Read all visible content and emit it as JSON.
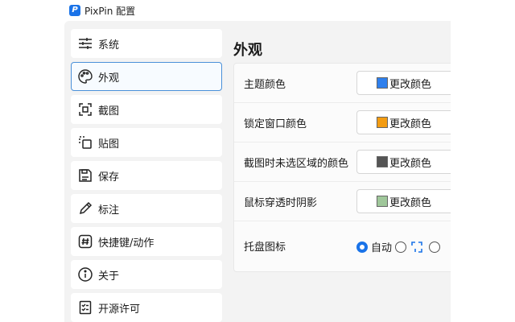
{
  "window": {
    "title": "PixPin 配置",
    "logo_letter": "P"
  },
  "sidebar": {
    "items": [
      {
        "label": "系统",
        "icon": "sliders-icon"
      },
      {
        "label": "外观",
        "icon": "palette-icon",
        "active": true
      },
      {
        "label": "截图",
        "icon": "screenshot-frame-icon"
      },
      {
        "label": "贴图",
        "icon": "pin-image-icon"
      },
      {
        "label": "保存",
        "icon": "save-icon"
      },
      {
        "label": "标注",
        "icon": "pencil-icon"
      },
      {
        "label": "快捷键/动作",
        "icon": "hash-icon"
      },
      {
        "label": "关于",
        "icon": "info-icon"
      },
      {
        "label": "开源许可",
        "icon": "checklist-icon"
      }
    ]
  },
  "main": {
    "title": "外观",
    "settings": [
      {
        "label": "主题颜色",
        "button_label": "更改颜色",
        "swatch_color": "#2f80ed"
      },
      {
        "label": "锁定窗口颜色",
        "button_label": "更改颜色",
        "swatch_color": "#f39c12"
      },
      {
        "label": "截图时未选区域的颜色",
        "button_label": "更改颜色",
        "swatch_color": "#555555"
      },
      {
        "label": "鼠标穿透时阴影",
        "button_label": "更改颜色",
        "swatch_color": "#9fc79a"
      }
    ],
    "tray": {
      "label": "托盘图标",
      "options": [
        {
          "label": "自动",
          "checked": true
        },
        {
          "label": "",
          "icon": "tray-blue-icon"
        },
        {
          "label": ""
        }
      ]
    }
  },
  "colors": {
    "accent": "#1a73e8",
    "active_border": "#4a90d9"
  }
}
